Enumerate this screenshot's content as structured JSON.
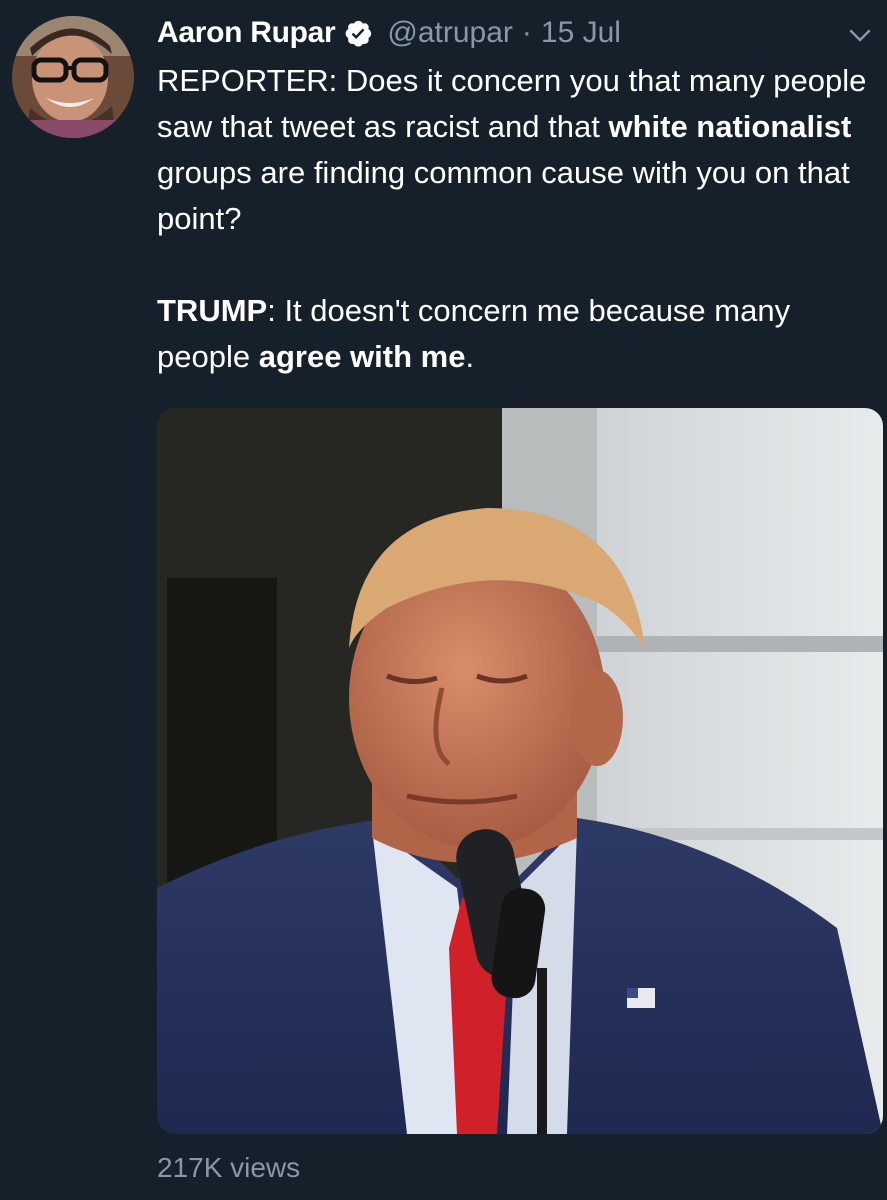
{
  "author": {
    "display_name": "Aaron Rupar",
    "handle": "@atrupar",
    "separator": "·",
    "date": "15 Jul",
    "verified": true,
    "avatar_icon": "avatar-photo"
  },
  "tweet": {
    "line1_plain": "REPORTER: Does it concern you that many people saw that tweet as racist and that ",
    "line1_bold": "white nationalist",
    "line1_end": " groups are finding common cause with you on that point?",
    "line2_bold_a": "TRUMP",
    "line2_plain": ": It doesn't concern me because many people ",
    "line2_bold_b": "agree with me",
    "line2_end": "."
  },
  "media": {
    "type": "video",
    "icon": "video-thumbnail"
  },
  "stats": {
    "views": "217K views"
  },
  "colors": {
    "background": "#15202b",
    "text_primary": "#ffffff",
    "text_secondary": "#8899a6",
    "verified_badge": "#ffffff"
  }
}
